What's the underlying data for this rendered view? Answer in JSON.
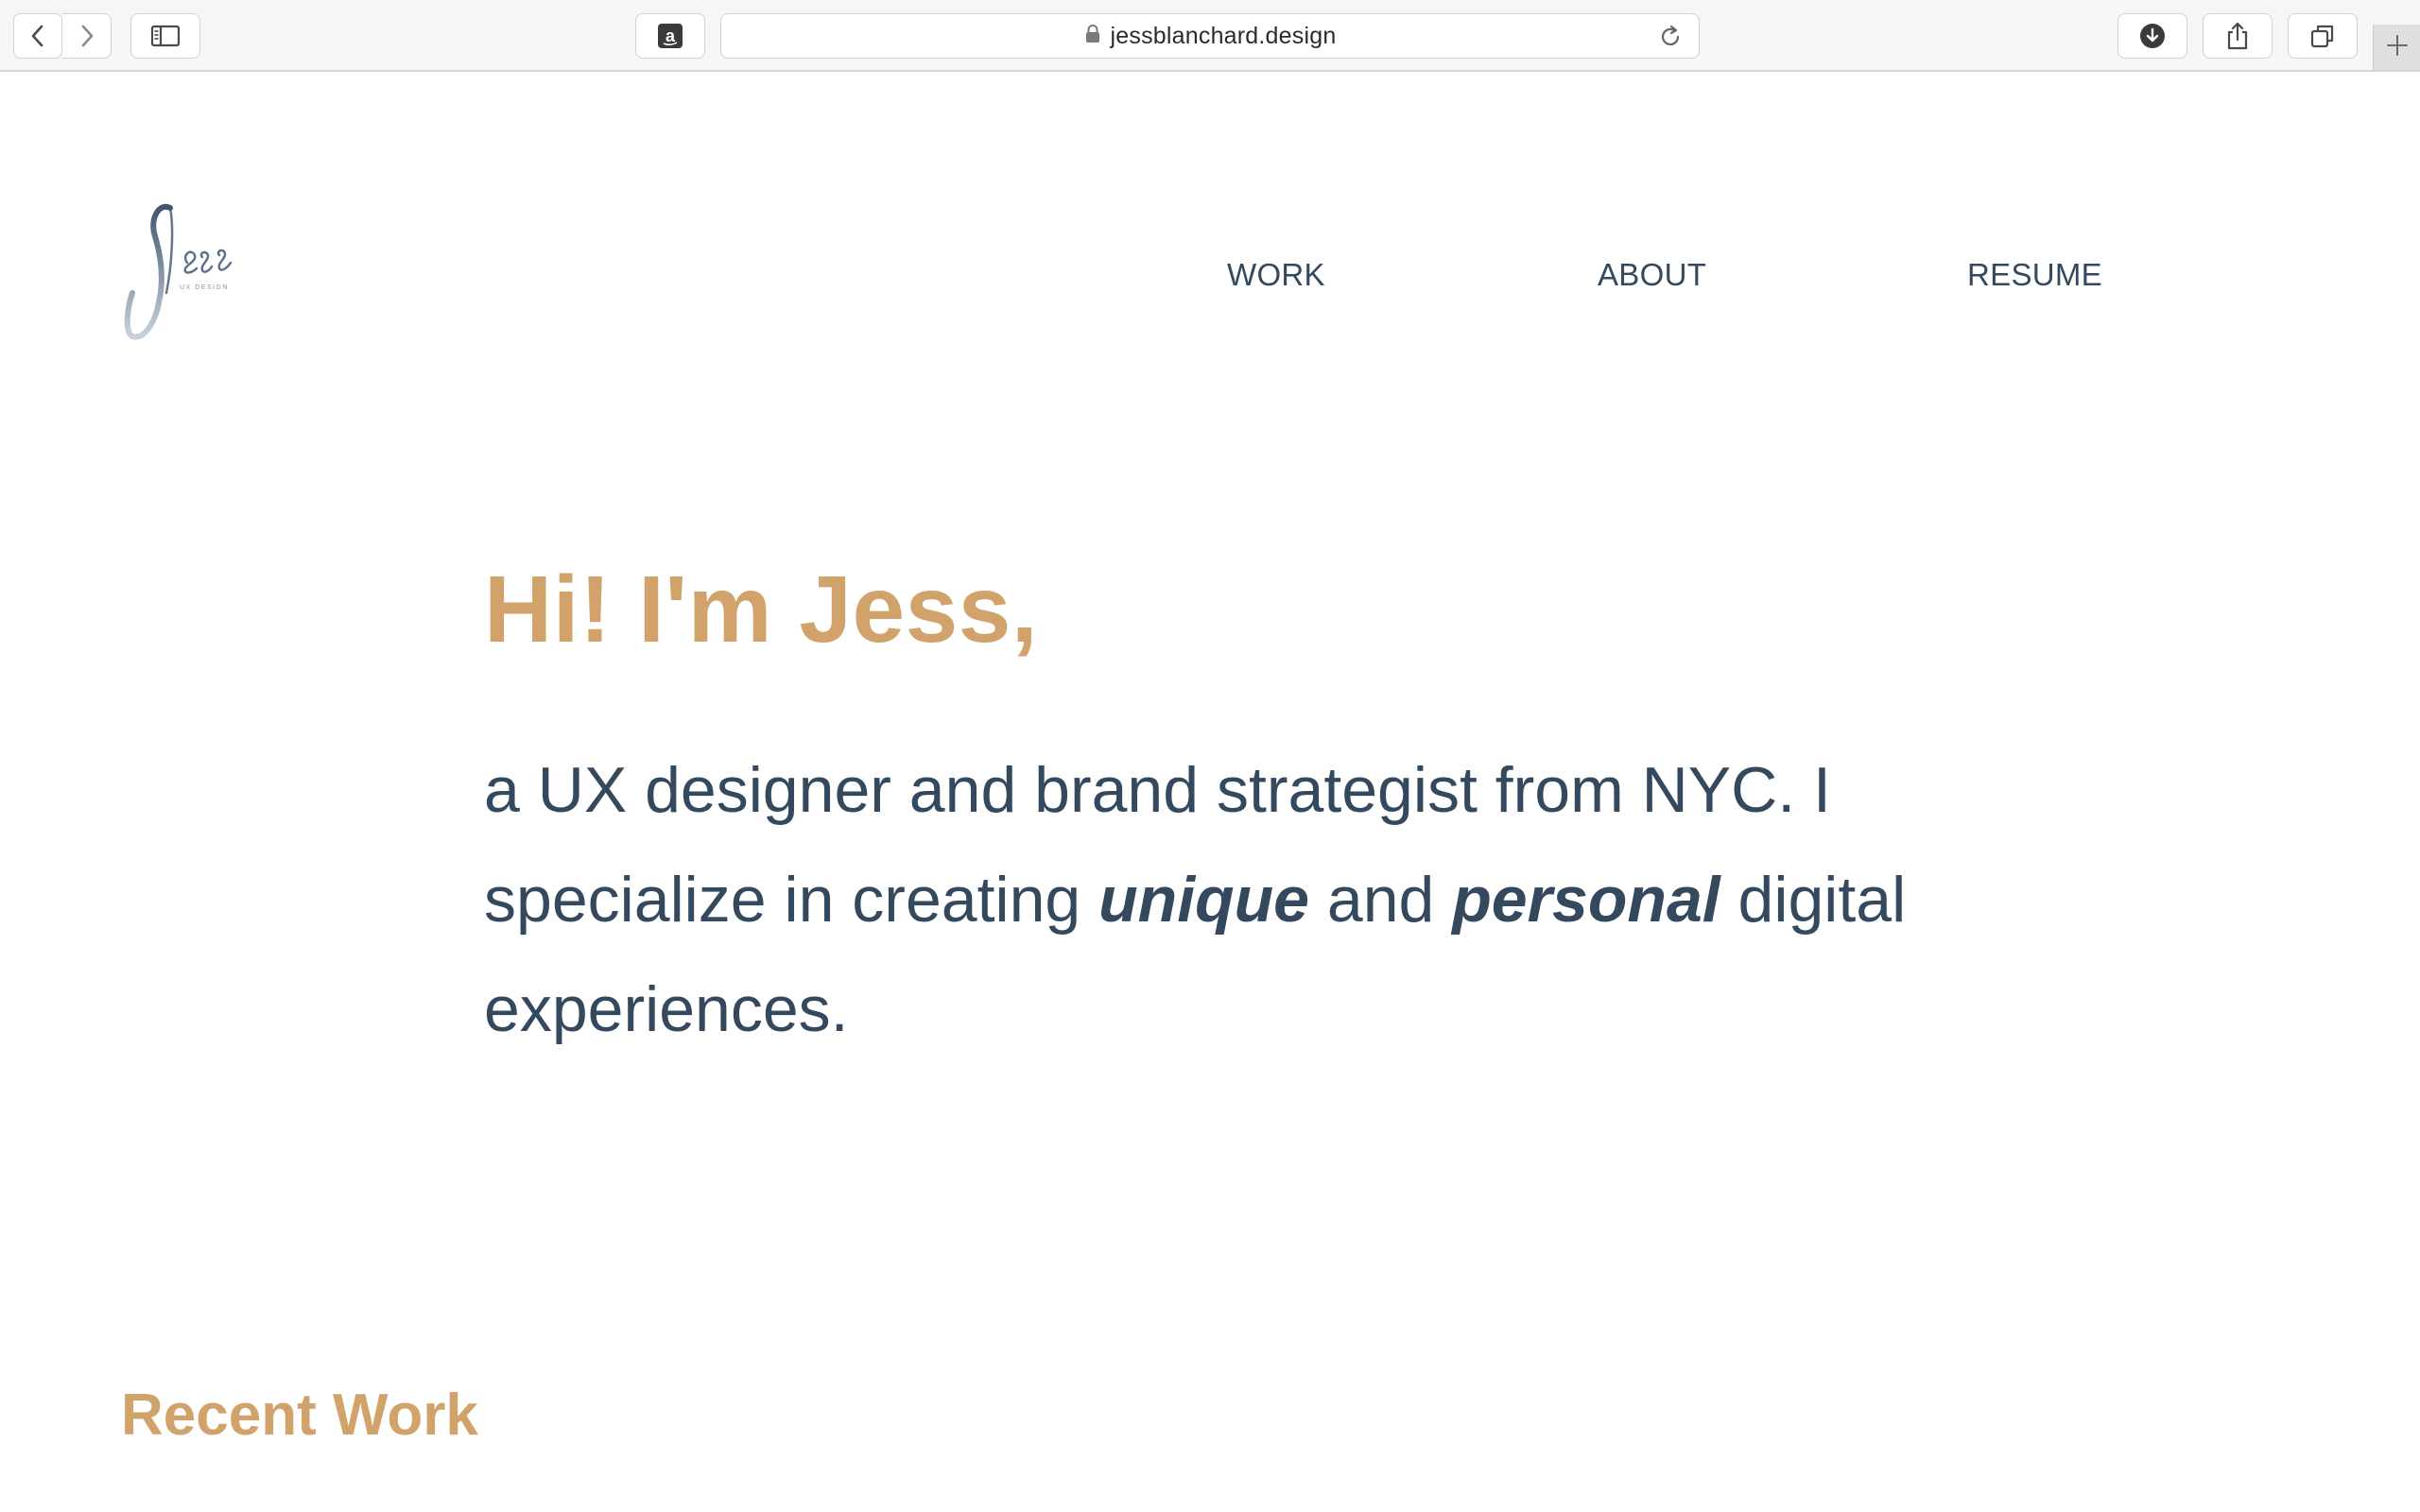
{
  "browser": {
    "url": "jessblanchard.design",
    "toolbar_icons": [
      "chevron-left-icon",
      "chevron-right-icon",
      "sidebar-icon",
      "amazon-icon",
      "lock-icon",
      "reload-icon",
      "download-icon",
      "share-icon",
      "tabs-icon",
      "plus-icon"
    ]
  },
  "logo": {
    "script_text": "Jess",
    "tagline": "UX DESIGN"
  },
  "nav": {
    "items": [
      {
        "label": "WORK"
      },
      {
        "label": "ABOUT"
      },
      {
        "label": "RESUME"
      }
    ]
  },
  "hero": {
    "title": "Hi! I'm Jess,",
    "intro_part1": "a UX designer and brand strategist from NYC. I specialize in creating ",
    "emphasis1": "unique",
    "connector": " and ",
    "emphasis2": "personal",
    "intro_part2": " digital experiences."
  },
  "sections": {
    "recent_work_title": "Recent Work"
  },
  "colors": {
    "accent_gold": "#d1a36b",
    "navy_text": "#34495e",
    "toolbar_bg": "#f6f6f6"
  }
}
